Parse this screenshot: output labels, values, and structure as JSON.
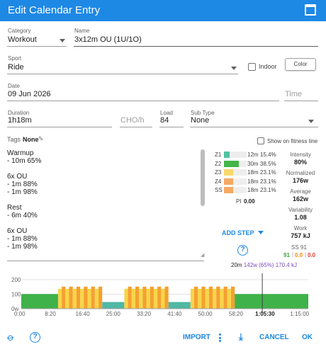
{
  "dialog": {
    "title": "Edit Calendar Entry"
  },
  "form": {
    "category": {
      "label": "Category",
      "value": "Workout"
    },
    "name": {
      "label": "Name",
      "value": "3x12m OU (1U/1O)"
    },
    "sport": {
      "label": "Sport",
      "value": "Ride"
    },
    "indoor_label": "Indoor",
    "color_button": "Color",
    "date": {
      "label": "Date",
      "value": "09 Jun 2026"
    },
    "time": {
      "placeholder": "Time"
    },
    "duration": {
      "label": "Duration",
      "value": "1h18m"
    },
    "cho": {
      "placeholder": "CHO/h"
    },
    "load": {
      "label": "Load",
      "value": "84"
    },
    "subtype": {
      "label": "Sub Type",
      "value": "None"
    },
    "tags": {
      "label": "Tags",
      "value": "None"
    },
    "show_on_fitness_line": "Show on fitness line"
  },
  "workout_text": [
    "Warmup",
    "- 10m 65%",
    "",
    "6x OU",
    "- 1m 88%",
    "- 1m 98%",
    "",
    "Rest",
    "- 6m 40%",
    "",
    "6x OU",
    "- 1m 88%",
    "- 1m 98%"
  ],
  "zones": [
    {
      "name": "Z1",
      "time": "12m",
      "pct": "15.4%",
      "fraction": 0.154,
      "color": "#4fc3a1"
    },
    {
      "name": "Z2",
      "time": "30m",
      "pct": "38.5%",
      "fraction": 0.385,
      "color": "#43b649"
    },
    {
      "name": "Z3",
      "time": "18m",
      "pct": "23.1%",
      "fraction": 0.231,
      "color": "#f7d96a"
    },
    {
      "name": "Z4",
      "time": "18m",
      "pct": "23.1%",
      "fraction": 0.231,
      "color": "#f5a962"
    },
    {
      "name": "SS",
      "time": "18m",
      "pct": "23.1%",
      "fraction": 0.231,
      "color": "#f5a962"
    }
  ],
  "pi": {
    "label": "PI",
    "value": "0.00"
  },
  "metrics": [
    {
      "label": "Intensity",
      "value": "80%"
    },
    {
      "label": "Normalized",
      "value": "176w"
    },
    {
      "label": "Average",
      "value": "162w"
    },
    {
      "label": "Variability",
      "value": "1.08"
    },
    {
      "label": "Work",
      "value": "757 kJ"
    }
  ],
  "ss": {
    "label": "SS 91",
    "green": "91",
    "orange": "0.0",
    "red": "0.0"
  },
  "add_step": "ADD STEP",
  "chart_summary": {
    "duration": "20m",
    "power": "142w (65%)",
    "work": "170.4 kJ"
  },
  "chart_data": {
    "type": "area",
    "ylim": [
      0,
      200
    ],
    "y_ticks": [
      "200",
      "100",
      "0w"
    ],
    "x_ticks": [
      "0:00",
      "8:20",
      "16:40",
      "25:00",
      "33:20",
      "41:40",
      "50:00",
      "58:20",
      "1:05:30",
      "1:15:00"
    ],
    "cursor": "1:05:30",
    "x_max_min": 78,
    "segments": [
      {
        "start": 0,
        "end": 10,
        "watts": 101,
        "zone": "Z2"
      },
      {
        "start": 10,
        "end": 22,
        "repeat": 6,
        "on_watts": 152,
        "on_zone": "Z4",
        "off_watts": 137,
        "off_zone": "Z3"
      },
      {
        "start": 22,
        "end": 28,
        "watts": 46,
        "zone": "Z1"
      },
      {
        "start": 28,
        "end": 40,
        "repeat": 6,
        "on_watts": 152,
        "on_zone": "Z4",
        "off_watts": 137,
        "off_zone": "Z3"
      },
      {
        "start": 40,
        "end": 46,
        "watts": 46,
        "zone": "Z1"
      },
      {
        "start": 46,
        "end": 58,
        "repeat": 6,
        "on_watts": 152,
        "on_zone": "Z4",
        "off_watts": 137,
        "off_zone": "Z3"
      },
      {
        "start": 58,
        "end": 78,
        "watts": 101,
        "zone": "Z2"
      }
    ]
  },
  "footer": {
    "import": "IMPORT",
    "cancel": "CANCEL",
    "ok": "OK"
  }
}
